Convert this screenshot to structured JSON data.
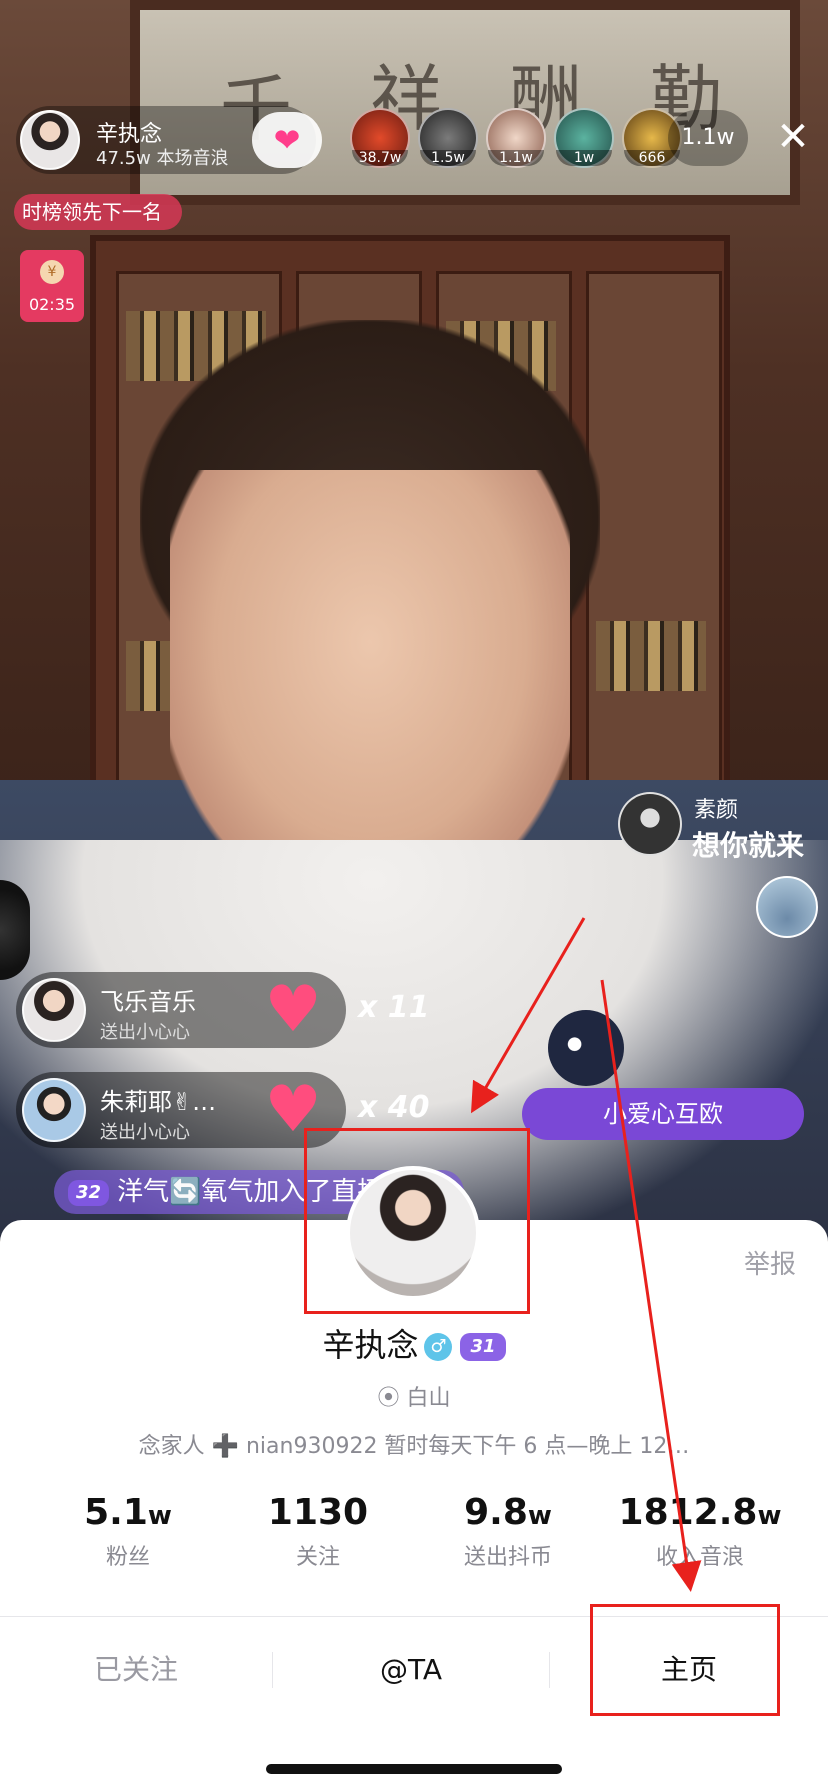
{
  "host": {
    "name": "辛执念",
    "subtitle": "47.5w 本场音浪"
  },
  "viewers": [
    "38.7w",
    "1.5w",
    "1.1w",
    "1w",
    "666"
  ],
  "viewer_count": "1.1w",
  "rank_banner": "时榜领先下一名",
  "red_packet": {
    "timer": "02:35"
  },
  "background_calligraphy": [
    "千",
    "祥",
    "酬",
    "勤"
  ],
  "gifts": [
    {
      "user": "飞乐音乐",
      "action": "送出小心心",
      "count": "x 11"
    },
    {
      "user": "朱莉耶✌…",
      "action": "送出小心心",
      "count": "x 40"
    }
  ],
  "chat_comment": {
    "level": "32",
    "text": "洋气🔄氧气加入了直播间"
  },
  "right_comment": {
    "name": "素颜",
    "text": "想你就来"
  },
  "cat_banner": "小爱心互欧",
  "profile": {
    "report": "举报",
    "name": "辛执念",
    "gender_symbol": "♂",
    "level": "31",
    "location": "白山",
    "bio": "念家人 ➕ nian930922 暂时每天下午 6 点—晚上 12…",
    "stats": [
      {
        "value": "5.1",
        "unit": "w",
        "label": "粉丝"
      },
      {
        "value": "1130",
        "unit": "",
        "label": "关注"
      },
      {
        "value": "9.8",
        "unit": "w",
        "label": "送出抖币"
      },
      {
        "value": "1812.8",
        "unit": "w",
        "label": "收入音浪"
      }
    ],
    "actions": {
      "followed": "已关注",
      "mention": "@TA",
      "homepage": "主页"
    }
  }
}
